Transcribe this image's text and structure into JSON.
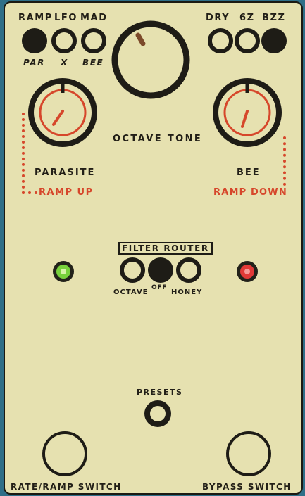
{
  "topLeft": {
    "labels_top": [
      "RAMP",
      "LFO",
      "MAD"
    ],
    "labels_bottom": [
      "PAR",
      "X",
      "BEE"
    ]
  },
  "topRight": {
    "labels_top": [
      "DRY",
      "6Z",
      "BZZ"
    ]
  },
  "knobs": {
    "octave_tone": "OCTAVE TONE",
    "parasite": "PARASITE",
    "parasite_ramp": "RAMP UP",
    "bee": "BEE",
    "bee_ramp": "RAMP DOWN"
  },
  "filter": {
    "title": "FILTER ROUTER",
    "left": "OCTAVE",
    "mid": "OFF",
    "right": "HONEY"
  },
  "presets": "PRESETS",
  "footswitches": {
    "left": "RATE/RAMP SWITCH",
    "right": "BYPASS SWITCH"
  },
  "colors": {
    "panel": "#e6e1b0",
    "ink": "#221f17",
    "accent_red": "#d6472b",
    "led_green": "#78d23c",
    "led_red": "#e23a38"
  }
}
